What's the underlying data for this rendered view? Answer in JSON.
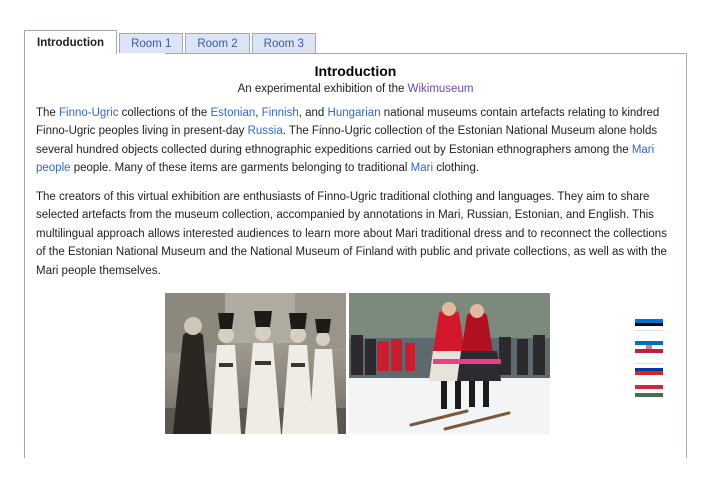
{
  "tabs": [
    {
      "label": "Introduction",
      "active": true
    },
    {
      "label": "Room 1",
      "active": false
    },
    {
      "label": "Room 2",
      "active": false
    },
    {
      "label": "Room 3",
      "active": false
    }
  ],
  "content": {
    "title": "Introduction",
    "subtitle_prefix": "An experimental exhibition of the ",
    "subtitle_link": "Wikimuseum",
    "p1": {
      "t1": "The ",
      "l1": "Finno-Ugric",
      "t2": " collections of the ",
      "l2": "Estonian",
      "t3": ", ",
      "l3": "Finnish",
      "t4": ", and ",
      "l4": "Hungarian",
      "t5": " national museums contain artefacts relating to kindred Finno-Ugric peoples living in present-day ",
      "l5": "Russia",
      "t6": ". The Finno-Ugric collection of the Estonian National Museum alone holds several hundred objects collected during ethnographic expeditions carried out by Estonian ethnographers among the ",
      "l6": "Mari people",
      "t7": " people. Many of these items are garments belonging to traditional ",
      "l7": "Mari",
      "t8": " clothing."
    },
    "p2": "The creators of this virtual exhibition are enthusiasts of Finno-Ugric traditional clothing and languages. They aim to share selected artefacts from the museum collection, accompanied by annotations in Mari, Russian, Estonian, and English. This multilingual approach allows interested audiences to learn more about Mari traditional dress and to reconnect the collections of the Estonian National Museum and the National Museum of Finland with public and private collections, as well as with the Mari people themselves."
  },
  "flags": [
    {
      "name": "estonia",
      "colors": [
        "#0072ce",
        "#000000",
        "#ffffff"
      ]
    },
    {
      "name": "mari-el",
      "colors": [
        "#0070c0",
        "#ffffff",
        "#c41e3a"
      ]
    },
    {
      "name": "russia",
      "colors": [
        "#ffffff",
        "#0039a6",
        "#d52b1e"
      ]
    },
    {
      "name": "hungary",
      "colors": [
        "#ce2939",
        "#ffffff",
        "#477050"
      ]
    }
  ]
}
